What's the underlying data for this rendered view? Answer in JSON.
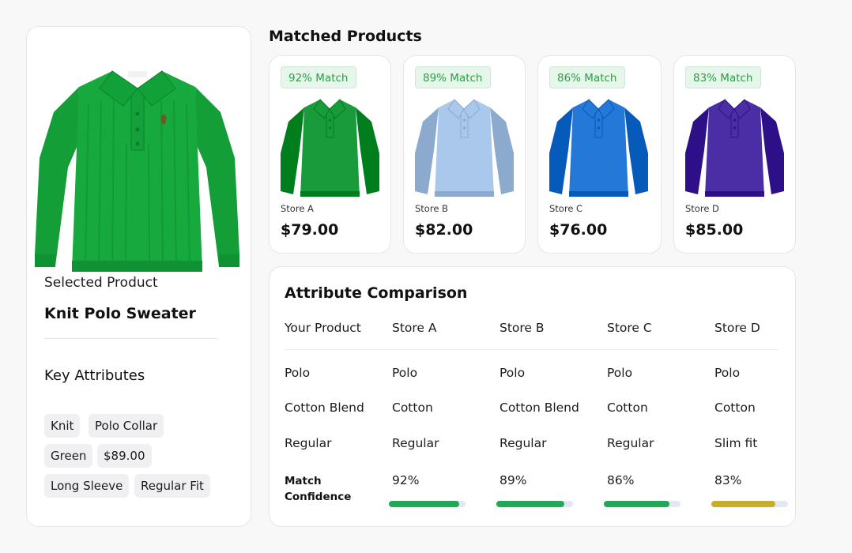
{
  "selected": {
    "label": "Selected Product",
    "name": "Knit Polo Sweater",
    "key_attributes_title": "Key Attributes",
    "tags": [
      "Knit",
      "Polo Collar",
      "Green",
      "$89.00",
      "Long Sleeve",
      "Regular Fit"
    ]
  },
  "matched": {
    "title": "Matched Products",
    "products": [
      {
        "badge": "92% Match",
        "store": "Store A",
        "price": "$79.00",
        "color": "#1a9b3b"
      },
      {
        "badge": "89% Match",
        "store": "Store B",
        "price": "$82.00",
        "color": "#a9c8ec"
      },
      {
        "badge": "86% Match",
        "store": "Store C",
        "price": "$76.00",
        "color": "#2478d8"
      },
      {
        "badge": "83% Match",
        "store": "Store D",
        "price": "$85.00",
        "color": "#4b2da6"
      }
    ]
  },
  "comparison": {
    "title": "Attribute Comparison",
    "headers": [
      "Your Product",
      "Store A",
      "Store B",
      "Store C",
      "Store D"
    ],
    "rows": [
      [
        "Polo",
        "Polo",
        "Polo",
        "Polo",
        "Polo"
      ],
      [
        "Cotton Blend",
        "Cotton",
        "Cotton Blend",
        "Cotton",
        "Cotton"
      ],
      [
        "Regular",
        "Regular",
        "Regular",
        "Regular",
        "Slim fit"
      ]
    ],
    "confidence_label": "Match Confidence",
    "confidence": [
      {
        "text": "92%",
        "value": 0.92,
        "color": "#22a957"
      },
      {
        "text": "89%",
        "value": 0.89,
        "color": "#22a957"
      },
      {
        "text": "86%",
        "value": 0.86,
        "color": "#22a957"
      },
      {
        "text": "83%",
        "value": 0.83,
        "color": "#c7ad2c"
      }
    ]
  },
  "colors": {
    "hero": "#14a23a"
  }
}
